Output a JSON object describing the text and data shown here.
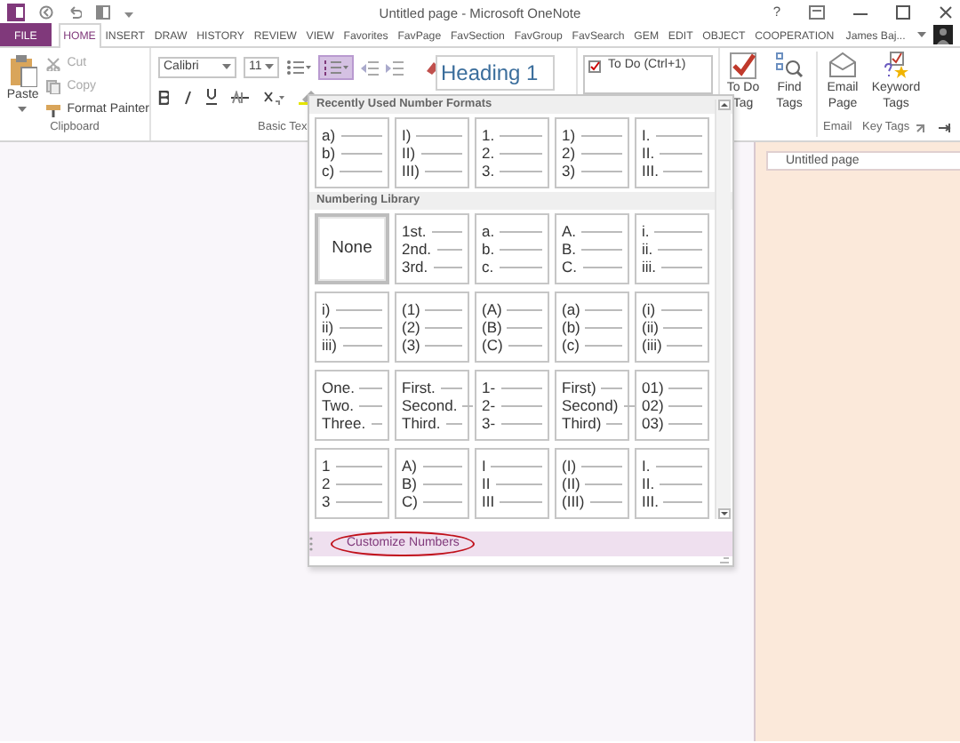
{
  "title_bar": {
    "title": "Untitled page - Microsoft OneNote",
    "help": "?"
  },
  "tabs": [
    {
      "label": "FILE",
      "kind": "file",
      "selected": false
    },
    {
      "label": "HOME",
      "kind": "tab",
      "selected": true
    },
    {
      "label": "INSERT",
      "kind": "tab",
      "selected": false
    },
    {
      "label": "DRAW",
      "kind": "tab",
      "selected": false
    },
    {
      "label": "HISTORY",
      "kind": "tab",
      "selected": false
    },
    {
      "label": "REVIEW",
      "kind": "tab",
      "selected": false
    },
    {
      "label": "VIEW",
      "kind": "tab",
      "selected": false
    },
    {
      "label": "Favorites",
      "kind": "tab",
      "selected": false
    },
    {
      "label": "FavPage",
      "kind": "tab",
      "selected": false
    },
    {
      "label": "FavSection",
      "kind": "tab",
      "selected": false
    },
    {
      "label": "FavGroup",
      "kind": "tab",
      "selected": false
    },
    {
      "label": "FavSearch",
      "kind": "tab",
      "selected": false
    },
    {
      "label": "GEM",
      "kind": "tab",
      "selected": false
    },
    {
      "label": "EDIT",
      "kind": "tab",
      "selected": false
    },
    {
      "label": "OBJECT",
      "kind": "tab",
      "selected": false
    },
    {
      "label": "COOPERATION",
      "kind": "tab",
      "selected": false
    }
  ],
  "account": {
    "name": "James Baj..."
  },
  "clipboard": {
    "paste": "Paste",
    "commands": [
      {
        "label": "Cut",
        "disabled": true
      },
      {
        "label": "Copy",
        "disabled": true
      },
      {
        "label": "Format Painter",
        "disabled": false
      }
    ],
    "label": "Clipboard"
  },
  "basic_text": {
    "font": "Calibri",
    "size": "11",
    "numbering_pressed": true,
    "label": "Basic Tex"
  },
  "styles": {
    "current": "Heading 1"
  },
  "tags": {
    "items": [
      "To Do (Ctrl+1)"
    ]
  },
  "big_buttons": [
    {
      "kind": "todo",
      "lines": [
        "To Do",
        "Tag"
      ]
    },
    {
      "kind": "find",
      "lines": [
        "Find",
        "Tags"
      ]
    },
    {
      "kind": "email",
      "lines": [
        "Email",
        "Page"
      ]
    },
    {
      "kind": "keyword",
      "lines": [
        "Keyword",
        "Tags"
      ]
    }
  ],
  "group_labels": [
    "Email",
    "Key Tags"
  ],
  "numbering_gallery": {
    "sections": [
      {
        "title": "Recently Used Number Formats",
        "items": [
          {
            "kind": "list",
            "markers": [
              "a)",
              "b)",
              "c)"
            ],
            "selected": false
          },
          {
            "kind": "list",
            "markers": [
              "I)",
              "II)",
              "III)"
            ],
            "selected": false
          },
          {
            "kind": "list",
            "markers": [
              "1.",
              "2.",
              "3."
            ],
            "selected": false
          },
          {
            "kind": "list",
            "markers": [
              "1)",
              "2)",
              "3)"
            ],
            "selected": false
          },
          {
            "kind": "list",
            "markers": [
              "I.",
              "II.",
              "III."
            ],
            "selected": false
          }
        ]
      },
      {
        "title": "Numbering Library",
        "items": [
          {
            "kind": "none",
            "label": "None",
            "selected": true
          },
          {
            "kind": "list",
            "markers": [
              "1st.",
              "2nd.",
              "3rd."
            ],
            "selected": false
          },
          {
            "kind": "list",
            "markers": [
              "a.",
              "b.",
              "c."
            ],
            "selected": false
          },
          {
            "kind": "list",
            "markers": [
              "A.",
              "B.",
              "C."
            ],
            "selected": false
          },
          {
            "kind": "list",
            "markers": [
              "i.",
              "ii.",
              "iii."
            ],
            "selected": false
          },
          {
            "kind": "list",
            "markers": [
              "i)",
              "ii)",
              "iii)"
            ],
            "selected": false
          },
          {
            "kind": "list",
            "markers": [
              "(1)",
              "(2)",
              "(3)"
            ],
            "selected": false
          },
          {
            "kind": "list",
            "markers": [
              "(A)",
              "(B)",
              "(C)"
            ],
            "selected": false
          },
          {
            "kind": "list",
            "markers": [
              "(a)",
              "(b)",
              "(c)"
            ],
            "selected": false
          },
          {
            "kind": "list",
            "markers": [
              "(i)",
              "(ii)",
              "(iii)"
            ],
            "selected": false
          },
          {
            "kind": "list",
            "markers": [
              "One.",
              "Two.",
              "Three."
            ],
            "selected": false
          },
          {
            "kind": "list",
            "markers": [
              "First.",
              "Second.",
              "Third."
            ],
            "selected": false
          },
          {
            "kind": "list",
            "markers": [
              "1-",
              "2-",
              "3-"
            ],
            "selected": false
          },
          {
            "kind": "list",
            "markers": [
              "First)",
              "Second)",
              "Third)"
            ],
            "selected": false
          },
          {
            "kind": "list",
            "markers": [
              "01)",
              "02)",
              "03)"
            ],
            "selected": false
          },
          {
            "kind": "list",
            "markers": [
              "1",
              "2",
              "3"
            ],
            "selected": false
          },
          {
            "kind": "list",
            "markers": [
              "A)",
              "B)",
              "C)"
            ],
            "selected": false
          },
          {
            "kind": "list",
            "markers": [
              "I",
              "II",
              "III"
            ],
            "selected": false
          },
          {
            "kind": "list",
            "markers": [
              "(I)",
              "(II)",
              "(III)"
            ],
            "selected": false
          },
          {
            "kind": "list",
            "markers": [
              "I.",
              "II.",
              "III."
            ],
            "selected": false
          }
        ]
      }
    ],
    "footer": {
      "label": "Customize Numbers",
      "circled": true
    }
  },
  "page_tabs": [
    {
      "title": "Untitled page",
      "selected": true
    }
  ]
}
